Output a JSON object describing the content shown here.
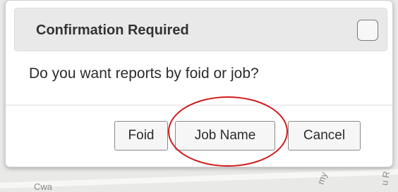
{
  "dialog": {
    "title": "Confirmation Required",
    "message": "Do you want reports by foid or job?",
    "buttons": {
      "foid": "Foid",
      "job_name": "Job Name",
      "cancel": "Cancel"
    }
  },
  "map": {
    "labels": [
      "Cwa",
      "my",
      "u R"
    ]
  },
  "colors": {
    "highlight": "#d01919",
    "titlebar": "#e9e9e9"
  }
}
